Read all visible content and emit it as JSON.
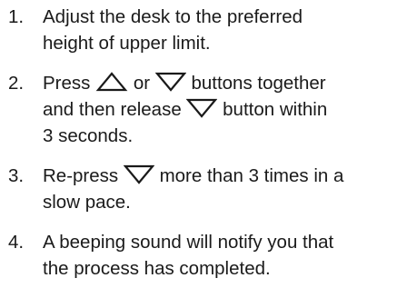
{
  "steps": [
    {
      "number": "1.",
      "line1": "Adjust the desk to the preferred",
      "line2": "height of upper limit."
    },
    {
      "number": "2.",
      "press": "Press",
      "or": "or",
      "line1_tail": "buttons together",
      "line2_lead": "and then release",
      "line2_tail": "button within",
      "line3": "3 seconds."
    },
    {
      "number": "3.",
      "repress": "Re-press",
      "line1_tail": "more than 3 times in a",
      "line2": "slow pace."
    },
    {
      "number": "4.",
      "line1": "A beeping sound will notify you that",
      "line2": "the process has completed."
    }
  ],
  "icons": {
    "up": "up-triangle-icon",
    "down": "down-triangle-icon"
  },
  "colors": {
    "text": "#1a1a1a",
    "background": "#ffffff"
  }
}
